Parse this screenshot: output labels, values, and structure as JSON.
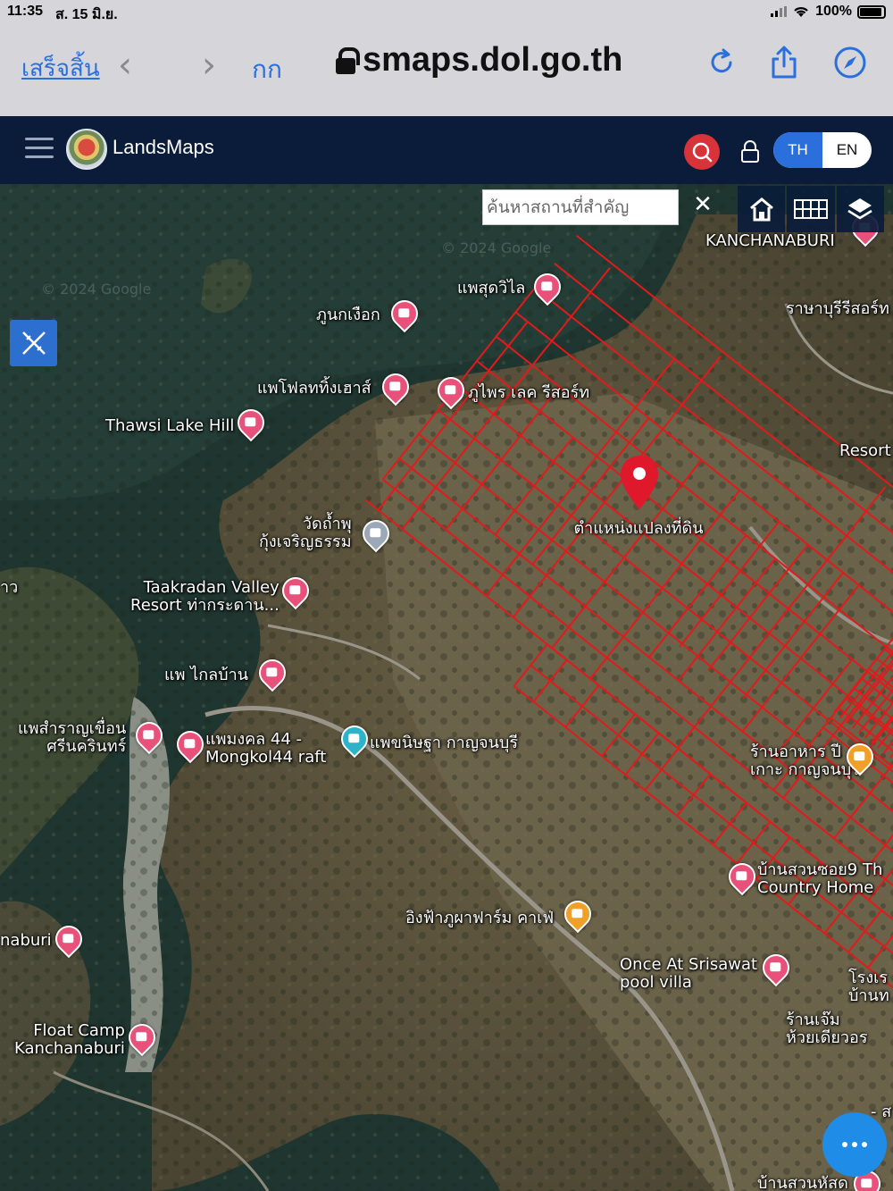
{
  "status_bar": {
    "time": "11:35",
    "date": "ส. 15 มิ.ย.",
    "battery": "100%"
  },
  "safari": {
    "done_label": "เสร็จสิ้น",
    "text_size_label": "กก",
    "url": "smaps.dol.go.th"
  },
  "header": {
    "app_name": "LandsMaps",
    "lang_th": "TH",
    "lang_en": "EN",
    "active_lang": "TH"
  },
  "search": {
    "placeholder": "ค้นหาสถานที่สำคัญ",
    "clear_label": "✕"
  },
  "map": {
    "watermark": "© 2024 Google",
    "parcel_pin_label": "ตำแหน่งแปลงที่ดิน",
    "places": [
      {
        "name": "แพสุดวิไล",
        "color": "#e8527a",
        "icon": "hotel-icon"
      },
      {
        "name": "ภูนกเงือก",
        "color": "#e8527a",
        "icon": "resort-icon"
      },
      {
        "name": "แพโฟลททิ้งเฮาส์",
        "color": "#e8527a",
        "icon": "hotel-icon"
      },
      {
        "name": "ภูไพร เลค รีสอร์ท",
        "color": "#e8527a",
        "icon": "resort-icon"
      },
      {
        "name": "Thawsi Lake Hill",
        "color": "#e8527a",
        "icon": "resort-icon"
      },
      {
        "name": "วัดถ้ำพุ\nกุ้งเจริญธรรม",
        "color": "#9aa8b8",
        "icon": "temple-icon"
      },
      {
        "name": "Taakradan Valley\nResort ท่ากระดาน...",
        "color": "#e8527a",
        "icon": "resort-icon"
      },
      {
        "name": "แพ ไกลบ้าน",
        "color": "#e8527a",
        "icon": "hotel-icon"
      },
      {
        "name": "แพสำราญเขื่อน\nศรีนครินทร์",
        "color": "#e8527a",
        "icon": "hotel-icon"
      },
      {
        "name": "แพมงคล 44 -\nMongkol44 raft",
        "color": "#e8527a",
        "icon": "hotel-icon"
      },
      {
        "name": "แพขนิษฐา กาญจนบุรี",
        "color": "#2bb3c9",
        "icon": "camera-icon"
      },
      {
        "name": "ร้านอาหาร ปี\nเกาะ กาญจนบุรี",
        "color": "#f0a028",
        "icon": "restaurant-icon"
      },
      {
        "name": "บ้านสวนซอย9 Th\nCountry Home",
        "color": "#e8527a",
        "icon": "hotel-icon"
      },
      {
        "name": "อิงฟ้าภูผาฟาร์ม คาเฟ่",
        "color": "#f0a028",
        "icon": "cafe-icon"
      },
      {
        "name": "Once At Srisawat\npool villa",
        "color": "#e8527a",
        "icon": "resort-icon"
      },
      {
        "name": "naburi",
        "color": "#e8527a",
        "icon": "hotel-icon"
      },
      {
        "name": "Float Camp\nKanchanaburi",
        "color": "#e8527a",
        "icon": "hotel-icon"
      },
      {
        "name": "บ้านสวนหัสด",
        "color": "#e8527a",
        "icon": "hotel-icon"
      },
      {
        "name": "KANCHANABURI",
        "color": "#e8527a",
        "icon": "hotel-icon"
      },
      {
        "name": "ราษาบุรีรีสอร์ท",
        "color": "#e8527a",
        "icon": "hotel-icon"
      },
      {
        "name": "Resort",
        "color": "#e8527a",
        "icon": "hotel-icon"
      },
      {
        "name": "โรงเร\nบ้านท",
        "color": "#e8527a",
        "icon": "hotel-icon"
      },
      {
        "name": "ร้านเจ๊ม\nห้วยเดียวอร",
        "color": "#e8527a",
        "icon": "hotel-icon"
      },
      {
        "name": "- ส",
        "color": "#e8527a",
        "icon": "hotel-icon"
      },
      {
        "name": "าว",
        "color": "#e8527a",
        "icon": "hotel-icon"
      }
    ],
    "parcel_color": "#e01b1b"
  }
}
